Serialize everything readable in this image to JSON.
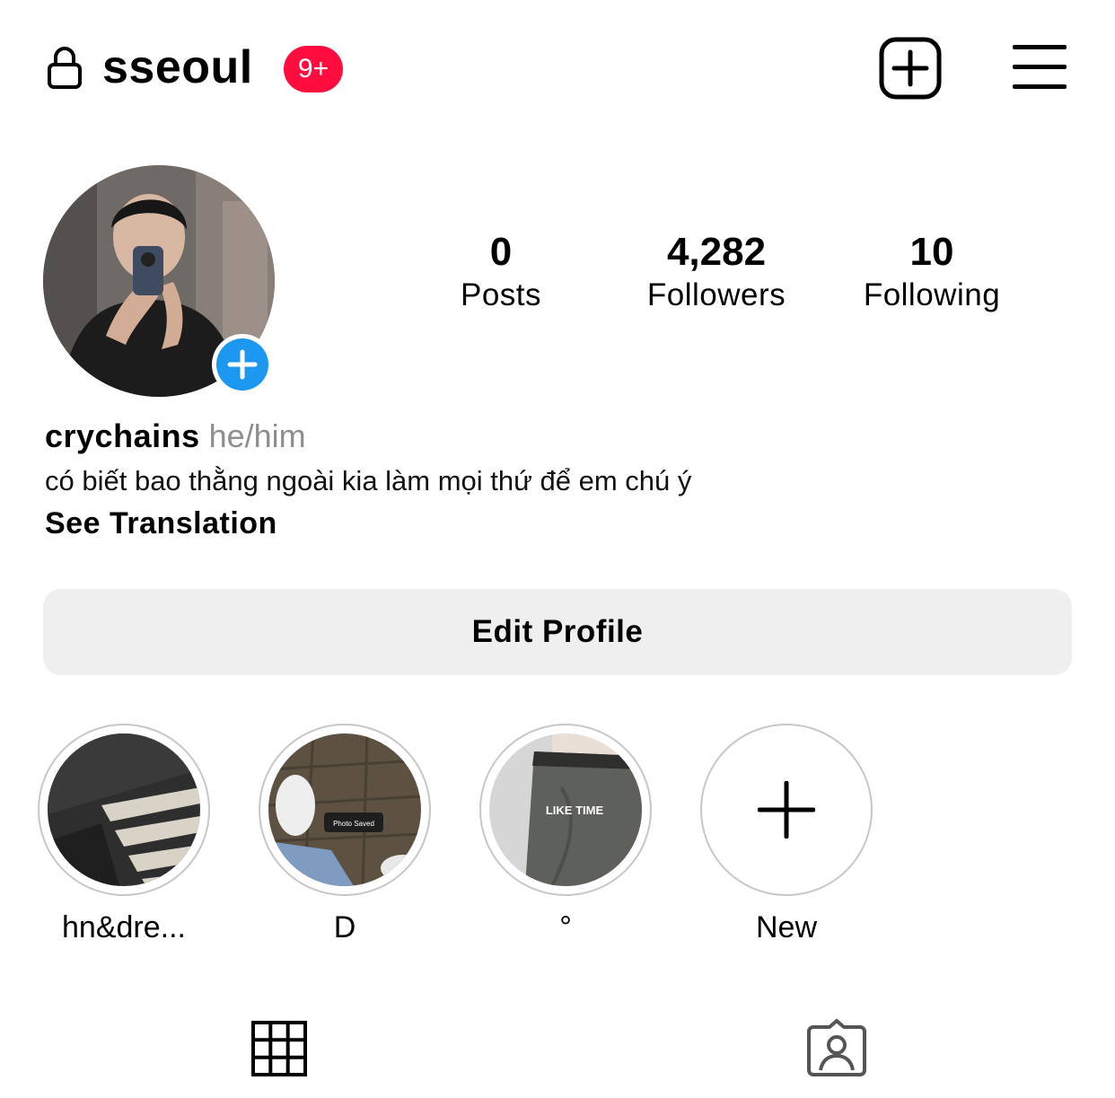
{
  "header": {
    "username": "sseoul",
    "notification_badge": "9+",
    "badge_color": "#ff0d3f"
  },
  "icons": {
    "lock": "lock-icon",
    "create": "plus-square-icon",
    "menu": "hamburger-menu-icon",
    "add_story": "plus-icon",
    "grid_tab": "grid-icon",
    "tagged_tab": "tagged-person-icon"
  },
  "stats": {
    "posts": {
      "value": "0",
      "label": "Posts"
    },
    "followers": {
      "value": "4,282",
      "label": "Followers"
    },
    "following": {
      "value": "10",
      "label": "Following"
    }
  },
  "profile": {
    "name": "crychains",
    "pronouns": "he/him",
    "bio": "có biết bao thằng ngoài kia làm mọi thứ để em chú ý",
    "see_translation": "See Translation",
    "accent_color": "#1d98f1"
  },
  "actions": {
    "edit_profile": "Edit Profile"
  },
  "highlights": [
    {
      "label": "hn&dre..."
    },
    {
      "label": "D",
      "image_text": "Photo Saved"
    },
    {
      "label": "°",
      "image_text": "LIKE TIME"
    },
    {
      "label": "New"
    }
  ]
}
